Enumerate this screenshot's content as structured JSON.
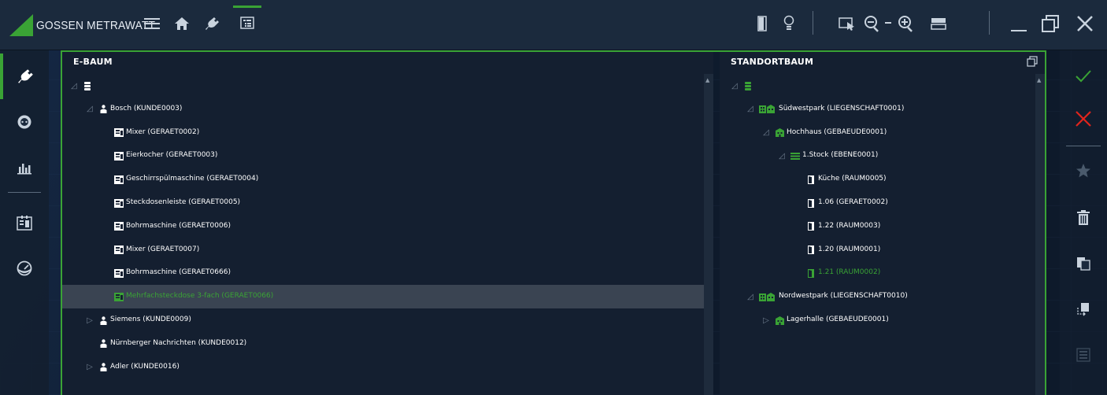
{
  "app": {
    "brand": "GOSSEN METRAWATT"
  },
  "topbar": {
    "icons": [
      "menu-icon",
      "home-icon",
      "plug-icon",
      "tree-view-icon"
    ],
    "right_icons": [
      "door-icon",
      "bulb-icon",
      "select-cursor-icon",
      "zoom-out-icon",
      "zoom-in-icon",
      "layout-icon",
      "minimize-icon",
      "restore-icon",
      "close-icon"
    ]
  },
  "leftbar": {
    "icons": [
      "plug-icon",
      "socket-icon",
      "chart-icon",
      "calendar-icon",
      "gauge-icon"
    ]
  },
  "rightbar": {
    "icons": [
      "check-icon",
      "cancel-icon",
      "star-icon",
      "trash-icon",
      "copy-icon",
      "move-icon",
      "export-icon"
    ]
  },
  "colors": {
    "accent": "#3aa335",
    "cancel": "#e1241c",
    "panel_bg": "#141f30",
    "selected_row": "#3a4452"
  },
  "ebaum": {
    "title": "E-BAUM",
    "rows": [
      {
        "label": "",
        "level": 0,
        "expander": "open",
        "icon": "database-icon"
      },
      {
        "label": "Bosch (KUNDE0003)",
        "level": 1,
        "expander": "open",
        "icon": "person-icon"
      },
      {
        "label": "Mixer (GERAET0002)",
        "level": 2,
        "expander": "",
        "icon": "device-icon"
      },
      {
        "label": "Eierkocher (GERAET0003)",
        "level": 2,
        "expander": "",
        "icon": "device-icon"
      },
      {
        "label": "Geschirrspülmaschine (GERAET0004)",
        "level": 2,
        "expander": "",
        "icon": "device-icon"
      },
      {
        "label": "Steckdosenleiste (GERAET0005)",
        "level": 2,
        "expander": "",
        "icon": "device-icon"
      },
      {
        "label": "Bohrmaschine (GERAET0006)",
        "level": 2,
        "expander": "",
        "icon": "device-icon"
      },
      {
        "label": "Mixer (GERAET0007)",
        "level": 2,
        "expander": "",
        "icon": "device-icon"
      },
      {
        "label": "Bohrmaschine (GERAET0666)",
        "level": 2,
        "expander": "",
        "icon": "device-icon"
      },
      {
        "label": "Mehrfachsteckdose 3-fach (GERAET0066)",
        "level": 2,
        "expander": "",
        "icon": "device-icon",
        "selected": true
      },
      {
        "label": "Siemens (KUNDE0009)",
        "level": 1,
        "expander": "closed",
        "icon": "person-icon"
      },
      {
        "label": "Nürnberger Nachrichten (KUNDE0012)",
        "level": 1,
        "expander": "",
        "icon": "person-icon"
      },
      {
        "label": "Adler (KUNDE0016)",
        "level": 1,
        "expander": "closed",
        "icon": "person-icon"
      }
    ]
  },
  "standortbaum": {
    "title": "STANDORTBAUM",
    "rows": [
      {
        "label": "",
        "level": 0,
        "expander": "open",
        "icon": "database-icon"
      },
      {
        "label": "Südwestpark (LIEGENSCHAFT0001)",
        "level": 1,
        "expander": "open",
        "icon": "property-icon"
      },
      {
        "label": "Hochhaus (GEBAEUDE0001)",
        "level": 2,
        "expander": "open",
        "icon": "building-icon"
      },
      {
        "label": "1.Stock (EBENE0001)",
        "level": 3,
        "expander": "open",
        "icon": "floor-icon"
      },
      {
        "label": "Küche (RAUM0005)",
        "level": 4,
        "expander": "",
        "icon": "room-icon"
      },
      {
        "label": "1.06 (GERAET0002)",
        "level": 4,
        "expander": "",
        "icon": "room-icon"
      },
      {
        "label": "1.22 (RAUM0003)",
        "level": 4,
        "expander": "",
        "icon": "room-icon"
      },
      {
        "label": "1.20 (RAUM0001)",
        "level": 4,
        "expander": "",
        "icon": "room-icon"
      },
      {
        "label": "1.21 (RAUM0002)",
        "level": 4,
        "expander": "",
        "icon": "room-icon",
        "highlight": true
      },
      {
        "label": "Nordwestpark (LIEGENSCHAFT0010)",
        "level": 1,
        "expander": "open",
        "icon": "property-icon"
      },
      {
        "label": "Lagerhalle (GEBAEUDE0001)",
        "level": 2,
        "expander": "closed",
        "icon": "building-icon"
      }
    ]
  }
}
